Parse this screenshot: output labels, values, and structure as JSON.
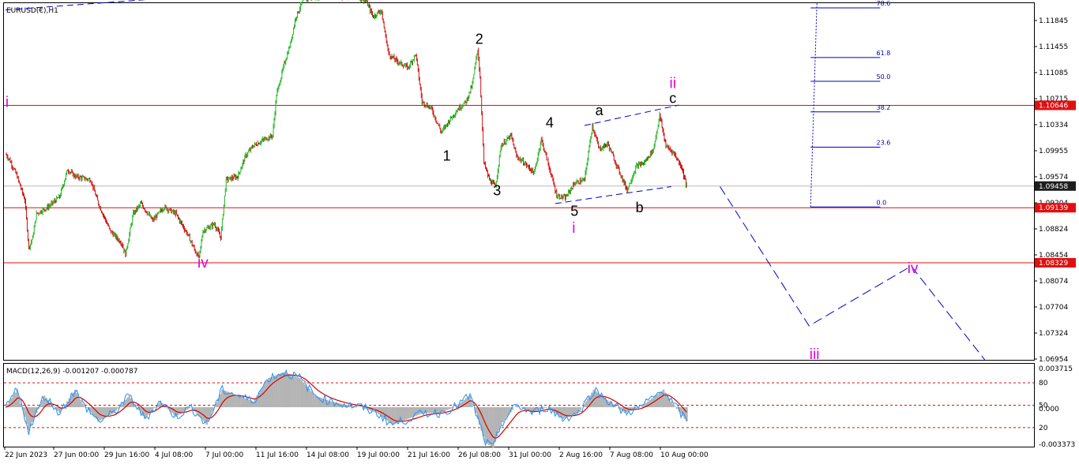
{
  "window": {
    "symbol_title": "EURUSD(€),H1"
  },
  "colors": {
    "bull": "#22b422",
    "bear": "#d01010",
    "hline": "#e01010",
    "trend": "#0000c8",
    "pink": "#e100e1",
    "macd_hist": "#b4b4b4",
    "macd_signal": "#d00000",
    "macd_line": "#1e90ff"
  },
  "chart_data": {
    "type": "candlestick",
    "y_axis_ticks": [
      "1.11845",
      "1.11455",
      "1.11085",
      "1.10715",
      "1.10334",
      "1.09955",
      "1.09574",
      "1.09204",
      "1.08824",
      "1.08454",
      "1.08074",
      "1.07704",
      "1.07324",
      "1.06954"
    ],
    "ylim": [
      1.069,
      1.1215
    ],
    "price_tags": [
      {
        "label": "1.10646",
        "value": 1.10646,
        "kind": "red"
      },
      {
        "label": "1.09458",
        "value": 1.09458,
        "kind": "dark"
      },
      {
        "label": "1.09139",
        "value": 1.09139,
        "kind": "red"
      },
      {
        "label": "1.08329",
        "value": 1.08329,
        "kind": "red"
      }
    ],
    "horizontal_lines": [
      1.10646,
      1.09139,
      1.08329
    ],
    "current_price": 1.09458,
    "x_axis_ticks": [
      "22 Jun 2023",
      "27 Jun 00:00",
      "29 Jun 16:00",
      "4 Jul 08:00",
      "7 Jul 00:00",
      "11 Jul 16:00",
      "14 Jul 08:00",
      "19 Jul 00:00",
      "21 Jul 16:00",
      "26 Jul 08:00",
      "31 Jul 00:00",
      "2 Aug 16:00",
      "7 Aug 08:00",
      "10 Aug 00:00"
    ],
    "price_path": [
      [
        0,
        1.0993
      ],
      [
        0.5,
        1.0985
      ],
      [
        1.5,
        1.096
      ],
      [
        2.5,
        1.0925
      ],
      [
        3,
        1.0855
      ],
      [
        3.5,
        1.087
      ],
      [
        4,
        1.0905
      ],
      [
        5.5,
        1.0915
      ],
      [
        7,
        1.093
      ],
      [
        8,
        1.097
      ],
      [
        9,
        1.096
      ],
      [
        11,
        1.0955
      ],
      [
        12,
        1.092
      ],
      [
        13.5,
        1.088
      ],
      [
        15,
        1.0862
      ],
      [
        15.5,
        1.0845
      ],
      [
        16.5,
        1.0905
      ],
      [
        17.5,
        1.092
      ],
      [
        19,
        1.0895
      ],
      [
        20.5,
        1.0915
      ],
      [
        22,
        1.0905
      ],
      [
        23.5,
        1.0875
      ],
      [
        24.5,
        1.085
      ],
      [
        25,
        1.084
      ],
      [
        25.5,
        1.088
      ],
      [
        27,
        1.089
      ],
      [
        27.8,
        1.087
      ],
      [
        28.5,
        1.0955
      ],
      [
        30,
        1.096
      ],
      [
        31,
        1.099
      ],
      [
        32,
        1.1005
      ],
      [
        33.5,
        1.1015
      ],
      [
        34.5,
        1.102
      ],
      [
        35,
        1.108
      ],
      [
        36,
        1.1125
      ],
      [
        36.8,
        1.1155
      ],
      [
        37.5,
        1.1195
      ],
      [
        38.5,
        1.122
      ],
      [
        40,
        1.1225
      ],
      [
        43,
        1.1225
      ],
      [
        45,
        1.1225
      ],
      [
        46.5,
        1.122
      ],
      [
        47.5,
        1.1195
      ],
      [
        48.5,
        1.1205
      ],
      [
        49.5,
        1.114
      ],
      [
        50.5,
        1.113
      ],
      [
        52,
        1.112
      ],
      [
        53,
        1.114
      ],
      [
        53.8,
        1.107
      ],
      [
        55,
        1.106
      ],
      [
        56.3,
        1.1025
      ],
      [
        57.5,
        1.1045
      ],
      [
        58.5,
        1.106
      ],
      [
        59.5,
        1.107
      ],
      [
        60.3,
        1.1095
      ],
      [
        61,
        1.1148
      ],
      [
        61.3,
        1.1105
      ],
      [
        61.8,
        1.098
      ],
      [
        62.5,
        1.0955
      ],
      [
        63.3,
        1.0945
      ],
      [
        64,
        1.1005
      ],
      [
        65.3,
        1.102
      ],
      [
        66,
        1.099
      ],
      [
        67,
        1.098
      ],
      [
        68.3,
        1.0965
      ],
      [
        69.2,
        1.1015
      ],
      [
        70.3,
        1.097
      ],
      [
        71.2,
        1.0932
      ],
      [
        72.3,
        1.0928
      ],
      [
        73.5,
        1.095
      ],
      [
        74.8,
        1.0955
      ],
      [
        75.8,
        1.1035
      ],
      [
        76.7,
        1.1
      ],
      [
        77.8,
        1.1008
      ],
      [
        79,
        1.0975
      ],
      [
        80.3,
        1.094
      ],
      [
        81.5,
        1.0975
      ],
      [
        82.5,
        1.098
      ],
      [
        83.7,
        1.1
      ],
      [
        84.5,
        1.105
      ],
      [
        85.3,
        1.1005
      ],
      [
        86.3,
        1.0995
      ],
      [
        87.3,
        1.0975
      ],
      [
        88,
        1.0945
      ]
    ],
    "macd": {
      "label": "MACD(12,26,9) -0.001207 -0.000787",
      "ticks": [
        "0.003715",
        "80",
        "50",
        "0.000",
        "20",
        "-0.003373"
      ],
      "ylim": [
        -0.003373,
        0.003715
      ],
      "levels": [
        80,
        50,
        20
      ],
      "path": [
        [
          0,
          0.0
        ],
        [
          1.5,
          0.0015
        ],
        [
          3,
          -0.002
        ],
        [
          5,
          0.001
        ],
        [
          7,
          -0.0005
        ],
        [
          9,
          0.0015
        ],
        [
          10,
          0.0003
        ],
        [
          12,
          -0.0012
        ],
        [
          14,
          -0.0005
        ],
        [
          16,
          0.001
        ],
        [
          18,
          -0.001
        ],
        [
          20,
          0.0005
        ],
        [
          22,
          -0.0008
        ],
        [
          24,
          0.0
        ],
        [
          26,
          -0.0015
        ],
        [
          28,
          0.0015
        ],
        [
          30,
          0.001
        ],
        [
          32,
          0.0005
        ],
        [
          34,
          0.0025
        ],
        [
          36,
          0.003
        ],
        [
          38,
          0.0025
        ],
        [
          40,
          0.001
        ],
        [
          42,
          0.0005
        ],
        [
          44,
          0.0002
        ],
        [
          46,
          0.0
        ],
        [
          48,
          -0.0005
        ],
        [
          50,
          -0.0015
        ],
        [
          52,
          -0.001
        ],
        [
          54,
          -0.0005
        ],
        [
          56,
          -0.0005
        ],
        [
          58,
          0.0
        ],
        [
          60,
          0.001
        ],
        [
          62,
          -0.003
        ],
        [
          63,
          -0.0035
        ],
        [
          64,
          -0.0015
        ],
        [
          66,
          0.0002
        ],
        [
          68,
          -0.0005
        ],
        [
          70,
          0.0
        ],
        [
          72,
          -0.001
        ],
        [
          74,
          -0.0005
        ],
        [
          76,
          0.0015
        ],
        [
          78,
          0.0005
        ],
        [
          80,
          -0.0005
        ],
        [
          82,
          0.0
        ],
        [
          84,
          0.001
        ],
        [
          85,
          0.0015
        ],
        [
          86,
          0.0005
        ],
        [
          88,
          -0.0012
        ]
      ]
    },
    "wave_labels": [
      {
        "text": "i",
        "x": 0.2,
        "y": 1.1062,
        "color": "pink"
      },
      {
        "text": "iv",
        "x": 25.5,
        "y": 1.0826,
        "color": "pink"
      },
      {
        "text": "1",
        "x": 57,
        "y": 1.0983,
        "color": "black"
      },
      {
        "text": "2",
        "x": 61.2,
        "y": 1.1155,
        "color": "black"
      },
      {
        "text": "3",
        "x": 63.5,
        "y": 1.0932,
        "color": "black"
      },
      {
        "text": "4",
        "x": 70.3,
        "y": 1.1032,
        "color": "black"
      },
      {
        "text": "5",
        "x": 73.5,
        "y": 1.0902,
        "color": "black"
      },
      {
        "text": "i",
        "x": 73.4,
        "y": 1.0877,
        "color": "pink"
      },
      {
        "text": "a",
        "x": 76.7,
        "y": 1.105,
        "color": "black"
      },
      {
        "text": "b",
        "x": 81.9,
        "y": 1.0907,
        "color": "black"
      },
      {
        "text": "c",
        "x": 86.2,
        "y": 1.1068,
        "color": "black"
      },
      {
        "text": "ii",
        "x": 86.2,
        "y": 1.109,
        "color": "pink"
      },
      {
        "text": "iii",
        "x": 104.5,
        "y": 1.0691,
        "color": "pink"
      },
      {
        "text": "iv",
        "x": 117.2,
        "y": 1.0818,
        "color": "pink"
      }
    ],
    "trendlines": [
      {
        "from": [
          0,
          1.1205
        ],
        "to": [
          30,
          1.123
        ],
        "style": "dashed"
      },
      {
        "from": [
          74.8,
          1.1035
        ],
        "to": [
          87,
          1.1065
        ],
        "style": "dashed"
      },
      {
        "from": [
          71,
          1.092
        ],
        "to": [
          86,
          1.0945
        ],
        "style": "dashed"
      }
    ],
    "projection_path": [
      [
        92.3,
        1.0945
      ],
      [
        103.8,
        1.074
      ],
      [
        117,
        1.0828
      ],
      [
        126.5,
        1.069
      ]
    ],
    "fibonacci": {
      "levels": [
        {
          "label": "78.6",
          "value": 1.1208
        },
        {
          "label": "61.8",
          "value": 1.1135
        },
        {
          "label": "50.0",
          "value": 1.11
        },
        {
          "label": "38.2",
          "value": 1.1055
        },
        {
          "label": "23.6",
          "value": 1.1003
        },
        {
          "label": "0.0",
          "value": 1.0915
        }
      ],
      "anchor_x": 104,
      "label_x": 112.5
    }
  }
}
